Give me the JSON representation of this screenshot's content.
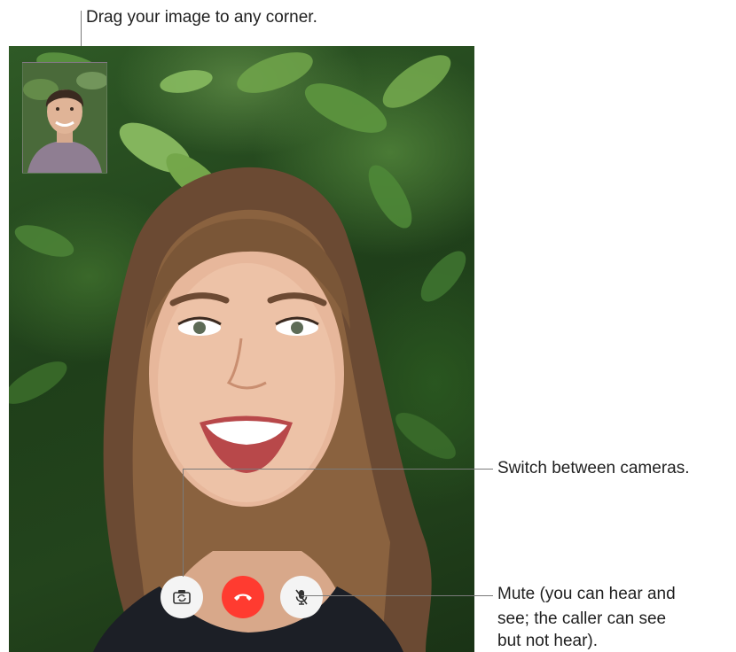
{
  "callouts": {
    "drag_pip": "Drag your image to any corner.",
    "switch_cameras": "Switch between cameras.",
    "mute_line1": "Mute (you can hear and",
    "mute_line2": "see; the caller can see",
    "mute_line3": "but not hear)."
  },
  "controls": {
    "switch_camera_icon": "camera-switch-icon",
    "end_call_icon": "phone-hangup-icon",
    "mute_icon": "microphone-slash-icon",
    "end_call_color": "#ff3b30",
    "button_color": "#f4f4f4"
  }
}
